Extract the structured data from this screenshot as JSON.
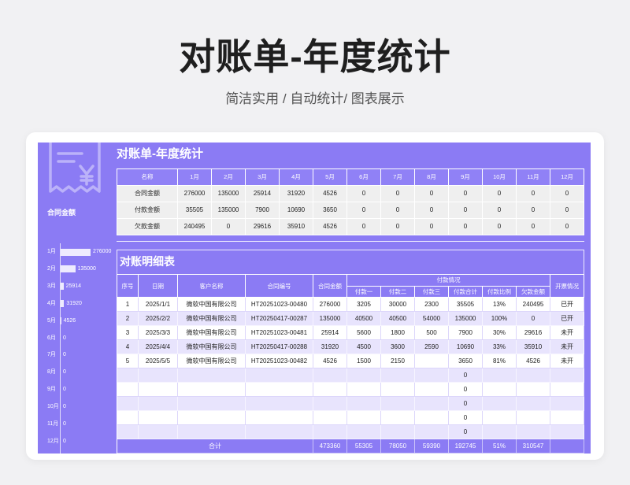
{
  "page": {
    "title": "对账单-年度统计",
    "subtitle": "简洁实用 / 自动统计/ 图表展示"
  },
  "colors": {
    "page_bg": "#f1f1f3",
    "primary": "#8b7bf4",
    "row_alt": "#e8e4fd",
    "summary_cell": "#efefef"
  },
  "side_panel": {
    "icon": "receipt-yen-icon",
    "chart_title": "合同金额",
    "chart": {
      "type": "bar",
      "orientation": "horizontal",
      "categories": [
        "1月",
        "2月",
        "3月",
        "4月",
        "5月",
        "6月",
        "7月",
        "8月",
        "9月",
        "10月",
        "11月",
        "12月"
      ],
      "values": [
        276000,
        135000,
        25914,
        31920,
        4526,
        0,
        0,
        0,
        0,
        0,
        0,
        0
      ]
    }
  },
  "sheet": {
    "title": "对账单-年度统计",
    "summary": {
      "headers": [
        "名称",
        "1月",
        "2月",
        "3月",
        "4月",
        "5月",
        "6月",
        "7月",
        "8月",
        "9月",
        "10月",
        "11月",
        "12月"
      ],
      "rows": [
        [
          "合同金额",
          "276000",
          "135000",
          "25914",
          "31920",
          "4526",
          "0",
          "0",
          "0",
          "0",
          "0",
          "0",
          "0"
        ],
        [
          "付款金额",
          "35505",
          "135000",
          "7900",
          "10690",
          "3650",
          "0",
          "0",
          "0",
          "0",
          "0",
          "0",
          "0"
        ],
        [
          "欠款金额",
          "240495",
          "0",
          "29616",
          "35910",
          "4526",
          "0",
          "0",
          "0",
          "0",
          "0",
          "0",
          "0"
        ]
      ]
    },
    "detail": {
      "title": "对账明细表",
      "headers": {
        "index": "序号",
        "date": "日期",
        "customer": "客户名称",
        "contract_no": "合同编号",
        "contract_amount": "合同金额",
        "payment_group": "付款情况",
        "invoice": "开票情况"
      },
      "sub_headers": [
        "付款一",
        "付款二",
        "付款三",
        "付款合计",
        "付款比例",
        "欠款金额"
      ],
      "rows": [
        [
          "1",
          "2025/1/1",
          "微软中国有限公司",
          "HT20251023-00480",
          "276000",
          "3205",
          "30000",
          "2300",
          "35505",
          "13%",
          "240495",
          "已开"
        ],
        [
          "2",
          "2025/2/2",
          "微软中国有限公司",
          "HT20250417-00287",
          "135000",
          "40500",
          "40500",
          "54000",
          "135000",
          "100%",
          "0",
          "已开"
        ],
        [
          "3",
          "2025/3/3",
          "微软中国有限公司",
          "HT20251023-00481",
          "25914",
          "5600",
          "1800",
          "500",
          "7900",
          "30%",
          "29616",
          "未开"
        ],
        [
          "4",
          "2025/4/4",
          "微软中国有限公司",
          "HT20250417-00288",
          "31920",
          "4500",
          "3600",
          "2590",
          "10690",
          "33%",
          "35910",
          "未开"
        ],
        [
          "5",
          "2025/5/5",
          "微软中国有限公司",
          "HT20251023-00482",
          "4526",
          "1500",
          "2150",
          "",
          "3650",
          "81%",
          "4526",
          "未开"
        ],
        [
          "",
          "",
          "",
          "",
          "",
          "",
          "",
          "",
          "0",
          "",
          "",
          ""
        ],
        [
          "",
          "",
          "",
          "",
          "",
          "",
          "",
          "",
          "0",
          "",
          "",
          ""
        ],
        [
          "",
          "",
          "",
          "",
          "",
          "",
          "",
          "",
          "0",
          "",
          "",
          ""
        ],
        [
          "",
          "",
          "",
          "",
          "",
          "",
          "",
          "",
          "0",
          "",
          "",
          ""
        ],
        [
          "",
          "",
          "",
          "",
          "",
          "",
          "",
          "",
          "0",
          "",
          "",
          ""
        ]
      ],
      "total": {
        "label": "合计",
        "values": [
          "473360",
          "55305",
          "78050",
          "59390",
          "192745",
          "51%",
          "310547",
          ""
        ]
      }
    }
  }
}
